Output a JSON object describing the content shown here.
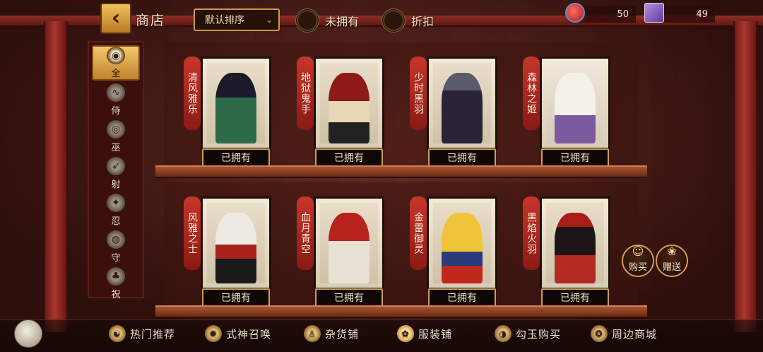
{
  "header": {
    "back_icon": "chevron-left",
    "shop_title": "商店",
    "sort_label": "默认排序",
    "filter_unowned": "未拥有",
    "filter_discount": "折扣",
    "currency_jade": "50",
    "currency_ticket": "49"
  },
  "sidebar": {
    "items": [
      {
        "label": "全",
        "icon": "all-icon",
        "active": true
      },
      {
        "label": "侍",
        "icon": "samurai-icon"
      },
      {
        "label": "巫",
        "icon": "shrine-icon"
      },
      {
        "label": "射",
        "icon": "archer-icon"
      },
      {
        "label": "忍",
        "icon": "ninja-icon"
      },
      {
        "label": "守",
        "icon": "guard-icon"
      },
      {
        "label": "祝",
        "icon": "blessing-icon"
      }
    ]
  },
  "skins": [
    {
      "name": "清风雅乐",
      "status": "已拥有",
      "accent": "#2e6a4a"
    },
    {
      "name": "地狱鬼手",
      "status": "已拥有",
      "accent": "#7a1a18"
    },
    {
      "name": "少时黑羽",
      "status": "已拥有",
      "accent": "#3a2c52"
    },
    {
      "name": "森林之姬",
      "status": "已拥有",
      "accent": "#d8cfc2"
    },
    {
      "name": "风雅之士",
      "status": "已拥有",
      "accent": "#c9c4bc"
    },
    {
      "name": "血月青空",
      "status": "已拥有",
      "accent": "#a82b22"
    },
    {
      "name": "金雷御灵",
      "status": "已拥有",
      "accent": "#e2b83a"
    },
    {
      "name": "黑焰火羽",
      "status": "已拥有",
      "accent": "#3a1410"
    }
  ],
  "actions": {
    "buy": "购买",
    "gift": "赠送"
  },
  "bottom_nav": [
    {
      "label": "热门推荐",
      "icon": "hot-icon"
    },
    {
      "label": "式神召唤",
      "icon": "summon-icon"
    },
    {
      "label": "杂货铺",
      "icon": "grocery-icon"
    },
    {
      "label": "服装铺",
      "icon": "costume-icon",
      "active": true
    },
    {
      "label": "勾玉购买",
      "icon": "jade-icon"
    },
    {
      "label": "周边商城",
      "icon": "merch-icon"
    }
  ]
}
